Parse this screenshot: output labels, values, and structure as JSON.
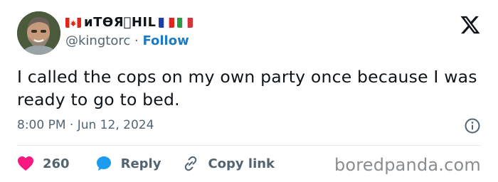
{
  "tweet": {
    "display_name": "ᴎTƟЯ⃤ᕼIᒪ",
    "handle": "@kingtorc",
    "separator": "·",
    "follow_label": "Follow",
    "text": "I called the cops on my own party once because I was ready to go to bed.",
    "time": "8:00 PM",
    "date_separator": "·",
    "date": "Jun 12, 2024",
    "likes": "260",
    "reply_label": "Reply",
    "copy_link_label": "Copy link"
  },
  "icons": {
    "platform": "x-logo-icon",
    "info": "info-icon",
    "like": "heart-icon",
    "reply": "speech-bubble-icon",
    "copy": "link-icon"
  },
  "colors": {
    "text": "#0f1419",
    "muted": "#536471",
    "link": "#1d7ac4",
    "heart": "#f91880",
    "reply_bubble": "#1d9bf0",
    "watermark": "#8a8d90"
  },
  "watermark": "boredpanda.com"
}
